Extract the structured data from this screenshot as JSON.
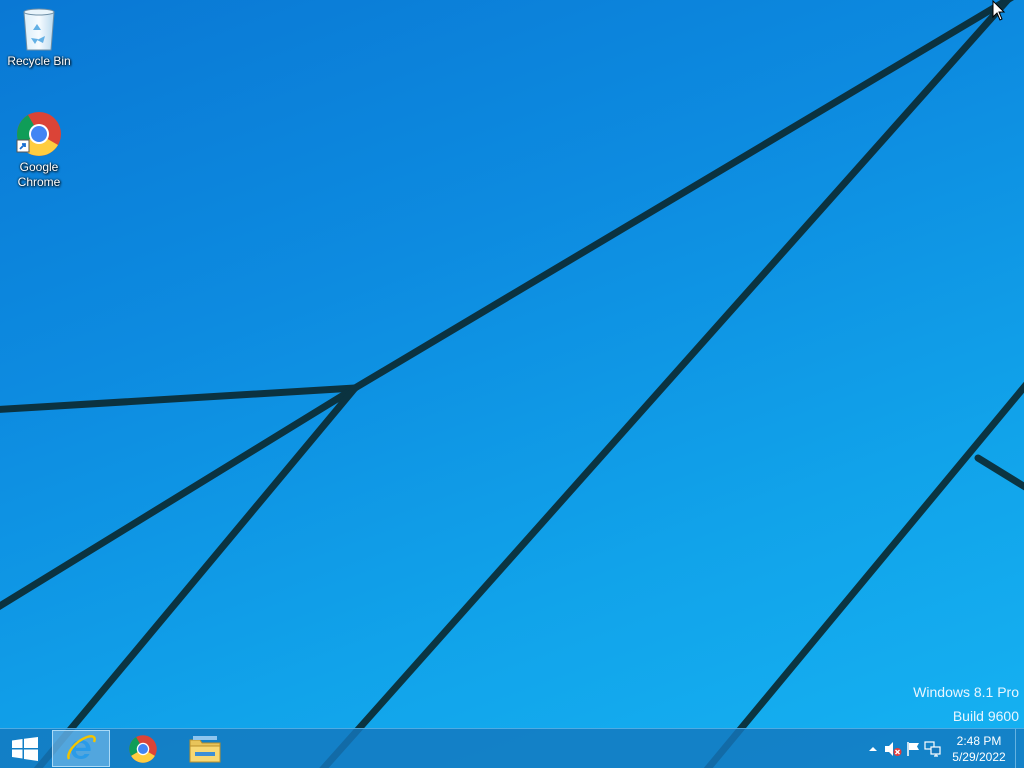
{
  "desktop": {
    "icons": [
      {
        "label": "Recycle Bin",
        "icon": "recycle-bin-icon"
      },
      {
        "label": "Google\nChrome",
        "icon": "chrome-icon"
      }
    ],
    "watermark": {
      "edition": "Windows 8.1 Pro",
      "build": "Build 9600"
    }
  },
  "taskbar": {
    "start_icon": "windows-logo-icon",
    "pinned": [
      {
        "name": "Internet Explorer",
        "icon": "internet-explorer-icon",
        "active": true
      },
      {
        "name": "Google Chrome",
        "icon": "chrome-icon",
        "active": false
      },
      {
        "name": "File Explorer",
        "icon": "file-explorer-icon",
        "active": false
      }
    ],
    "tray": {
      "icons": [
        "show-hidden-icons-arrow",
        "volume-muted-icon",
        "action-center-flag-icon",
        "network-icon"
      ],
      "time": "2:48 PM",
      "date": "5/29/2022"
    }
  },
  "colors": {
    "wallpaper_blue": "#0d8be0",
    "wallpaper_light": "#16b2f2",
    "wallpaper_lines": "#0b2a33",
    "taskbar": "#1478be"
  }
}
